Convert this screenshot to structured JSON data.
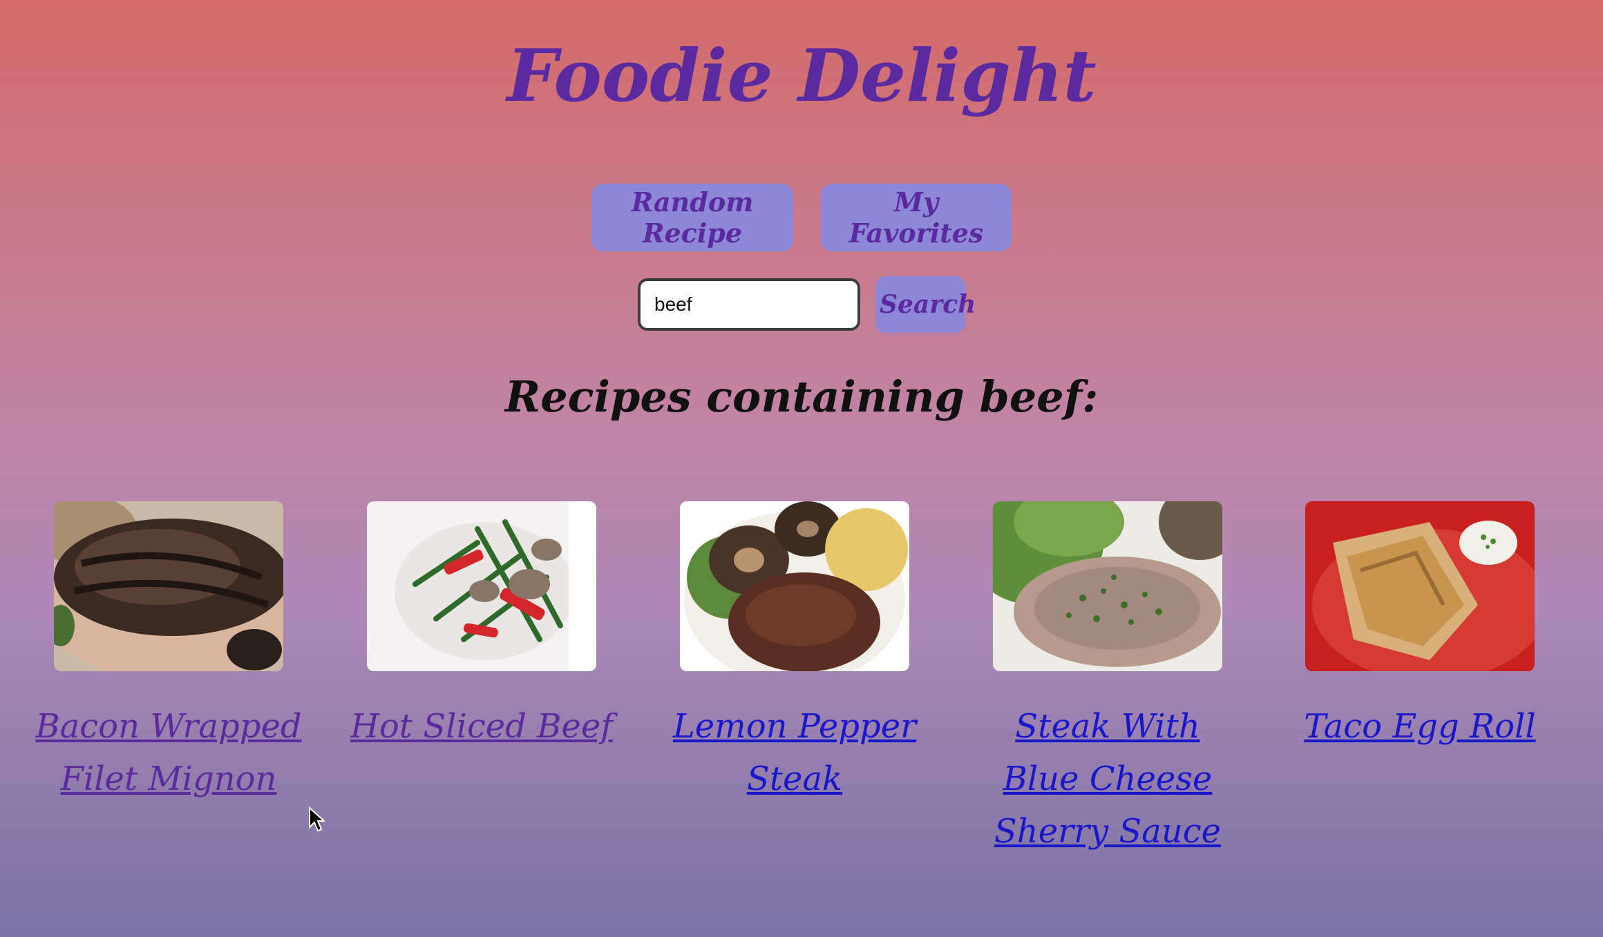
{
  "header": {
    "title": "Foodie Delight"
  },
  "nav": {
    "random_label": "Random Recipe",
    "favorites_label": "My Favorites"
  },
  "search": {
    "value": "beef",
    "button_label": "Search"
  },
  "results": {
    "heading": "Recipes containing beef:",
    "items": [
      {
        "title": "Bacon Wrapped Filet Mignon",
        "visited": true,
        "image_icon": "grilled-filet-photo"
      },
      {
        "title": "Hot Sliced Beef",
        "visited": true,
        "image_icon": "stir-fry-photo"
      },
      {
        "title": "Lemon Pepper Steak",
        "visited": false,
        "image_icon": "steak-mushroom-photo"
      },
      {
        "title": "Steak With Blue Cheese Sherry Sauce",
        "visited": false,
        "image_icon": "steak-herb-sauce-photo"
      },
      {
        "title": "Taco Egg Roll",
        "visited": false,
        "image_icon": "egg-roll-photo"
      }
    ]
  },
  "colors": {
    "title": "#5a2a9e",
    "button_bg": "#8e86d6",
    "link_visited": "#5a2a9e",
    "link_unvisited": "#1a16c9"
  }
}
